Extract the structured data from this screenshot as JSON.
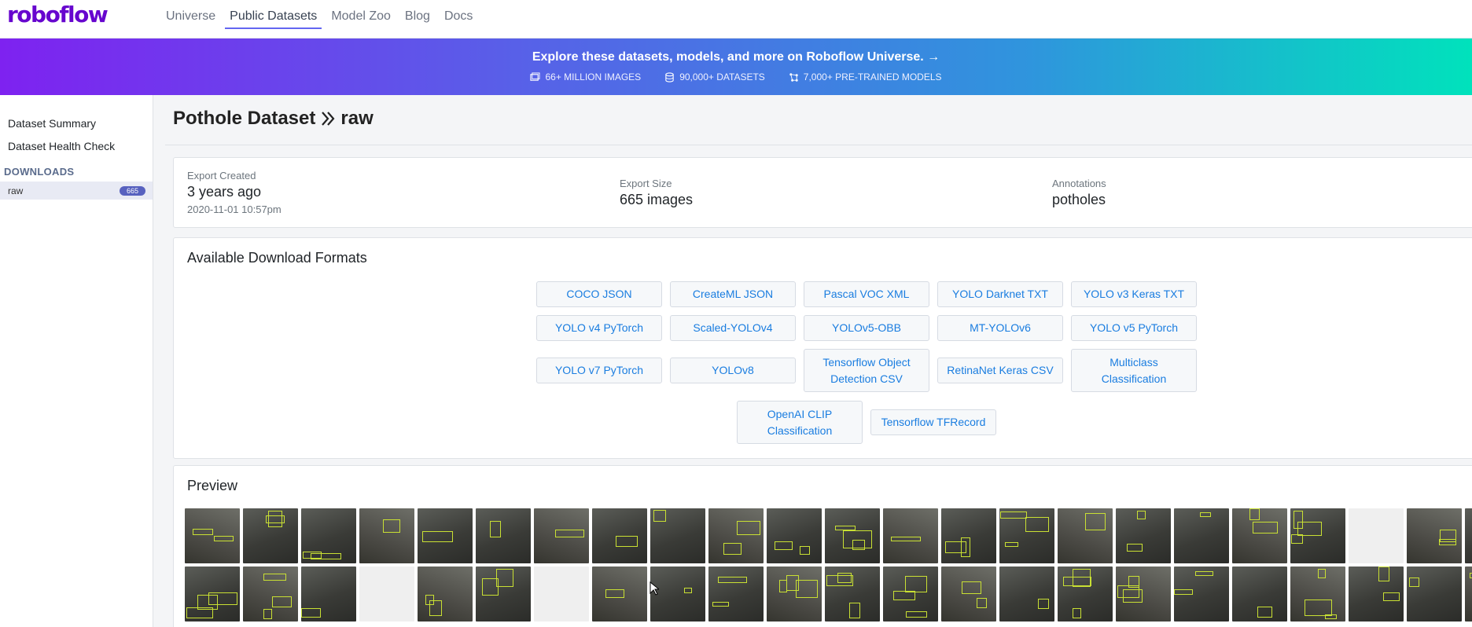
{
  "nav": {
    "logo": "roboflow",
    "links": [
      "Universe",
      "Public Datasets",
      "Model Zoo",
      "Blog",
      "Docs"
    ],
    "active": "Public Datasets"
  },
  "banner": {
    "title": "Explore these datasets, models, and more on Roboflow Universe. →",
    "stats": [
      "66+ MILLION IMAGES",
      "90,000+ DATASETS",
      "7,000+ PRE-TRAINED MODELS"
    ]
  },
  "sidebar": {
    "links": [
      "Dataset Summary",
      "Dataset Health Check"
    ],
    "downloads_header": "DOWNLOADS",
    "item_label": "raw",
    "item_badge": "665"
  },
  "page": {
    "dataset": "Pothole Dataset",
    "version": "raw"
  },
  "export": {
    "created_label": "Export Created",
    "created_value": "3 years ago",
    "created_date": "2020-11-01 10:57pm",
    "size_label": "Export Size",
    "size_value": "665 images",
    "annotations_label": "Annotations",
    "annotations_value": "potholes"
  },
  "formats": {
    "title": "Available Download Formats",
    "rows": [
      [
        "COCO JSON",
        "CreateML JSON",
        "Pascal VOC XML",
        "YOLO Darknet TXT",
        "YOLO v3 Keras TXT"
      ],
      [
        "YOLO v4 PyTorch",
        "Scaled-YOLOv4",
        "YOLOv5-OBB",
        "MT-YOLOv6",
        "YOLO v5 PyTorch"
      ],
      [
        "YOLO v7 PyTorch",
        "YOLOv8",
        "Tensorflow Object Detection CSV",
        "RetinaNet Keras CSV",
        "Multiclass Classification"
      ],
      [
        "OpenAI CLIP Classification",
        "Tensorflow TFRecord"
      ]
    ]
  },
  "preview": {
    "title": "Preview",
    "thumbnail_count_visible": 46
  },
  "colors": {
    "brand": "#6706ce",
    "link": "#1a7de0",
    "badge": "#5761bf",
    "annotation_box": "#c9e033"
  }
}
